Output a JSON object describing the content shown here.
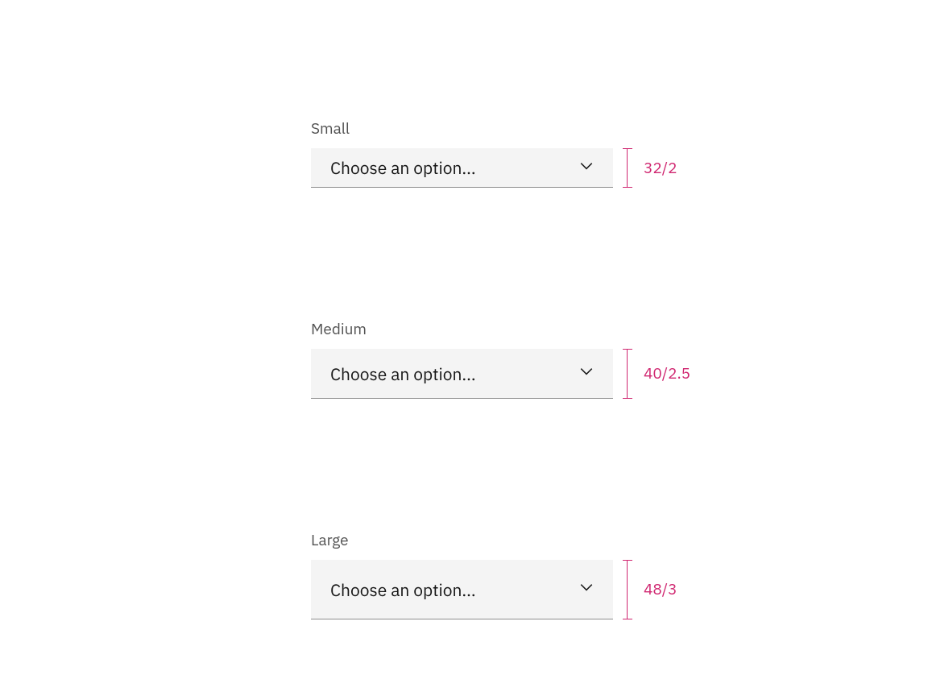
{
  "specs": [
    {
      "label": "Small",
      "placeholder": "Choose an option...",
      "size_class": "sm",
      "measure": "32/2"
    },
    {
      "label": "Medium",
      "placeholder": "Choose an option...",
      "size_class": "md",
      "measure": "40/2.5"
    },
    {
      "label": "Large",
      "placeholder": "Choose an option...",
      "size_class": "lg",
      "measure": "48/3"
    }
  ],
  "colors": {
    "measure": "#d02670",
    "field_bg": "#f4f4f4",
    "text": "#161616",
    "label": "#525252",
    "border": "#8d8d8d"
  }
}
